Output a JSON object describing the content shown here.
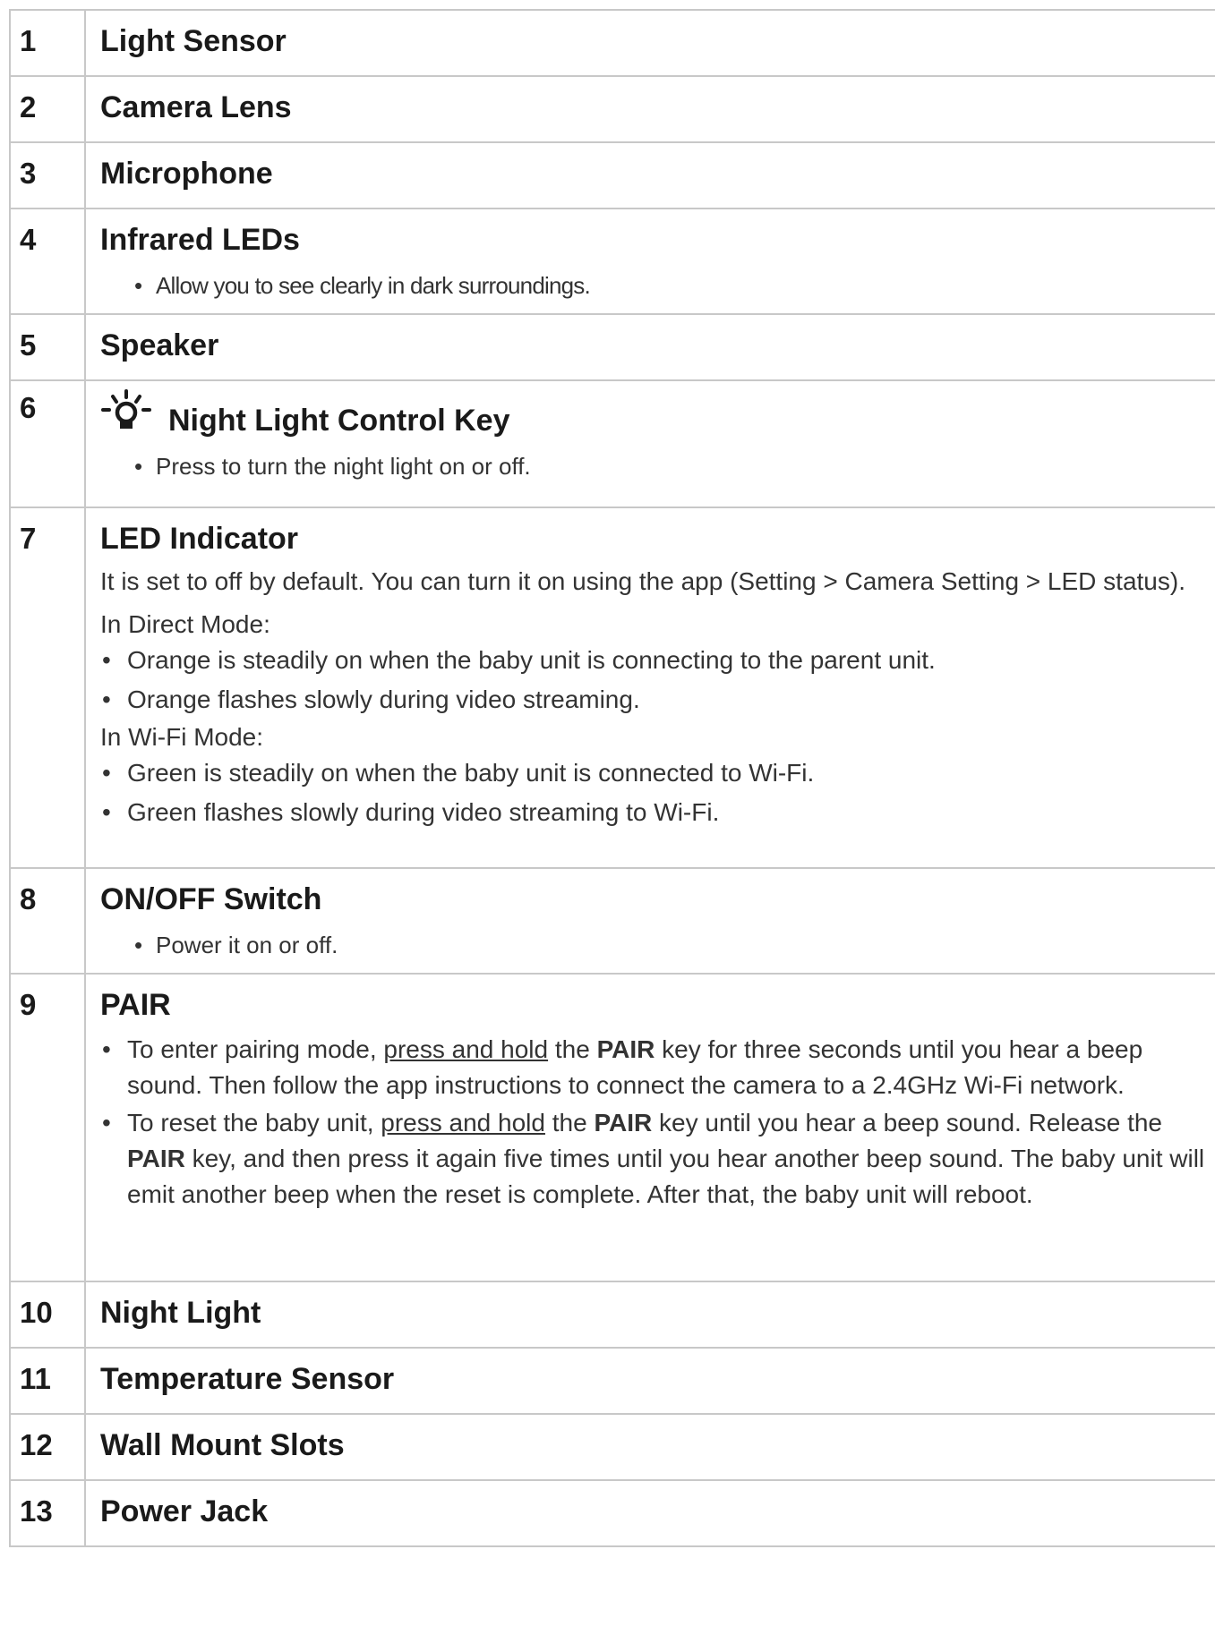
{
  "rows": [
    {
      "num": "1",
      "title": "Light Sensor"
    },
    {
      "num": "2",
      "title": "Camera Lens"
    },
    {
      "num": "3",
      "title": "Microphone"
    },
    {
      "num": "4",
      "title": "Infrared LEDs",
      "note": "Allow you to see clearly in dark surroundings."
    },
    {
      "num": "5",
      "title": "Speaker"
    },
    {
      "num": "6",
      "title": "Night Light Control Key",
      "icon": "night-light-bulb-icon",
      "note": "Press to turn the night light on or off."
    },
    {
      "num": "7",
      "title": "LED Indicator",
      "intro": "It is set to off by default. You can turn it on using the app (Setting > Camera Setting > LED status).",
      "direct_heading": "In Direct Mode:",
      "direct_items": [
        "Orange is steadily on when the baby unit is connecting to the parent unit.",
        "Orange flashes slowly during video streaming."
      ],
      "wifi_heading": "In Wi-Fi Mode:",
      "wifi_items": [
        "Green is steadily on when the baby unit is connected to Wi-Fi.",
        "Green flashes slowly during video streaming to Wi-Fi."
      ]
    },
    {
      "num": "8",
      "title": "ON/OFF Switch",
      "note": "Power it on or off."
    },
    {
      "num": "9",
      "title": "PAIR",
      "pair1": {
        "a": "To enter pairing mode, ",
        "u": "press and hold",
        "b": " the ",
        "k": "PAIR",
        "c": " key for three seconds until you hear a beep sound. Then follow the app instructions to connect the camera to a 2.4GHz Wi-Fi network."
      },
      "pair2": {
        "a": "To reset the baby unit, ",
        "u": "press and hold",
        "b": " the ",
        "k": "PAIR",
        "c": " key until you hear a beep sound. Release the ",
        "k2": "PAIR",
        "d": " key, and then press it again five times until you hear another beep sound.  The baby unit will emit another beep when the reset is complete. After that, the baby unit will reboot."
      }
    },
    {
      "num": "10",
      "title": "Night Light"
    },
    {
      "num": "11",
      "title": "Temperature Sensor"
    },
    {
      "num": "12",
      "title": "Wall Mount Slots"
    },
    {
      "num": "13",
      "title": "Power Jack"
    }
  ]
}
